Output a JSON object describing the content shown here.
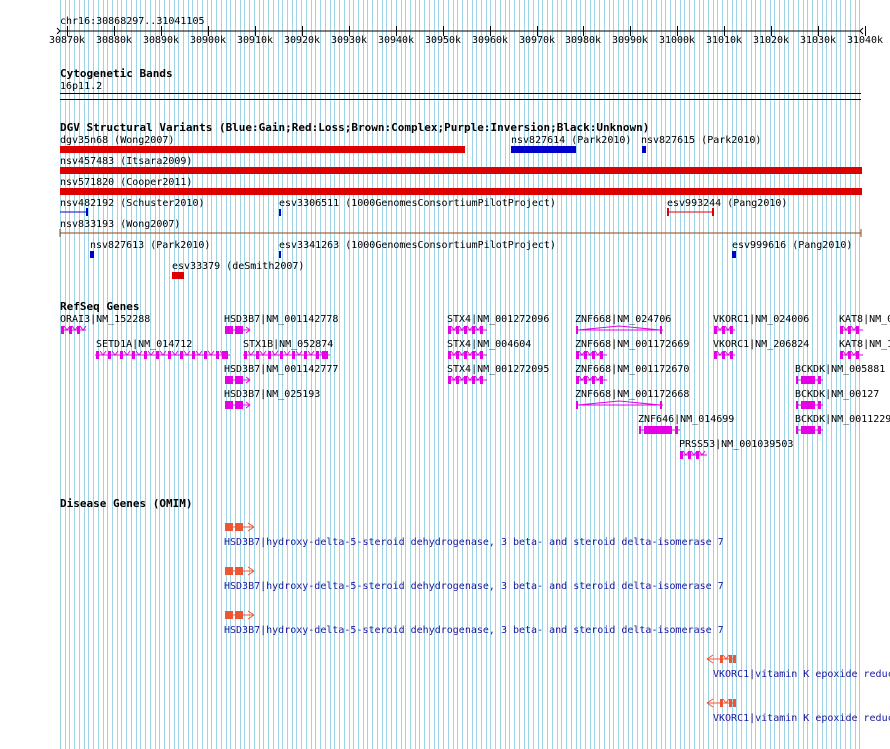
{
  "ruler": {
    "region": "chr16:30868297..31041105",
    "ticks": [
      "30870k",
      "30880k",
      "30890k",
      "30900k",
      "30910k",
      "30920k",
      "30930k",
      "30940k",
      "30950k",
      "30960k",
      "30970k",
      "30980k",
      "30990k",
      "31000k",
      "31010k",
      "31020k",
      "31030k",
      "31040k"
    ]
  },
  "cyto": {
    "title": "Cytogenetic Bands",
    "band": "16p11.2"
  },
  "dgv": {
    "title": "DGV Structural Variants (Blue:Gain;Red:Loss;Brown:Complex;Purple:Inversion;Black:Unknown)",
    "colors": {
      "gain": "#0000cc",
      "loss": "#dd0000",
      "complex": "#8b4513"
    },
    "items": [
      {
        "label": "dgv35n68 (Wong2007)",
        "type": "loss"
      },
      {
        "label": "nsv827614 (Park2010)",
        "type": "gain"
      },
      {
        "label": "nsv827615 (Park2010)",
        "type": "gain"
      },
      {
        "label": "nsv457483 (Itsara2009)",
        "type": "loss"
      },
      {
        "label": "nsv571820 (Cooper2011)",
        "type": "loss"
      },
      {
        "label": "nsv482192 (Schuster2010)",
        "type": "gain"
      },
      {
        "label": "esv3306511 (1000GenomesConsortiumPilotProject)",
        "type": "gain"
      },
      {
        "label": "esv993244 (Pang2010)",
        "type": "loss"
      },
      {
        "label": "nsv833193 (Wong2007)",
        "type": "complex"
      },
      {
        "label": "nsv827613 (Park2010)",
        "type": "gain"
      },
      {
        "label": "esv3341263 (1000GenomesConsortiumPilotProject)",
        "type": "gain"
      },
      {
        "label": "esv999616 (Pang2010)",
        "type": "gain"
      },
      {
        "label": "esv33379 (deSmith2007)",
        "type": "loss"
      }
    ]
  },
  "refseq": {
    "title": "RefSeq Genes",
    "color": "#e600e6",
    "genes": [
      "ORAI3|NM_152288",
      "SETD1A|NM_014712",
      "HSD3B7|NM_001142778",
      "STX1B|NM_052874",
      "HSD3B7|NM_001142777",
      "HSD3B7|NM_025193",
      "STX4|NM_001272096",
      "STX4|NM_004604",
      "STX4|NM_001272095",
      "ZNF668|NM_024706",
      "ZNF668|NM_001172669",
      "ZNF668|NM_001172670",
      "ZNF668|NM_001172668",
      "ZNF646|NM_014699",
      "PRSS53|NM_001039503",
      "VKORC1|NM_024006",
      "VKORC1|NM_206824",
      "BCKDK|NM_005881",
      "BCKDK|NM_00127",
      "BCKDK|NM_0011229",
      "KAT8|NM_0",
      "KAT8|NM_1"
    ]
  },
  "omim": {
    "title": "Disease Genes (OMIM)",
    "color": "#ee5533",
    "items": [
      "HSD3B7|hydroxy-delta-5-steroid dehydrogenase, 3 beta- and steroid delta-isomerase 7",
      "HSD3B7|hydroxy-delta-5-steroid dehydrogenase, 3 beta- and steroid delta-isomerase 7",
      "HSD3B7|hydroxy-delta-5-steroid dehydrogenase, 3 beta- and steroid delta-isomerase 7",
      "VKORC1|vitamin K epoxide reduc",
      "VKORC1|vitamin K epoxide reduc"
    ]
  }
}
